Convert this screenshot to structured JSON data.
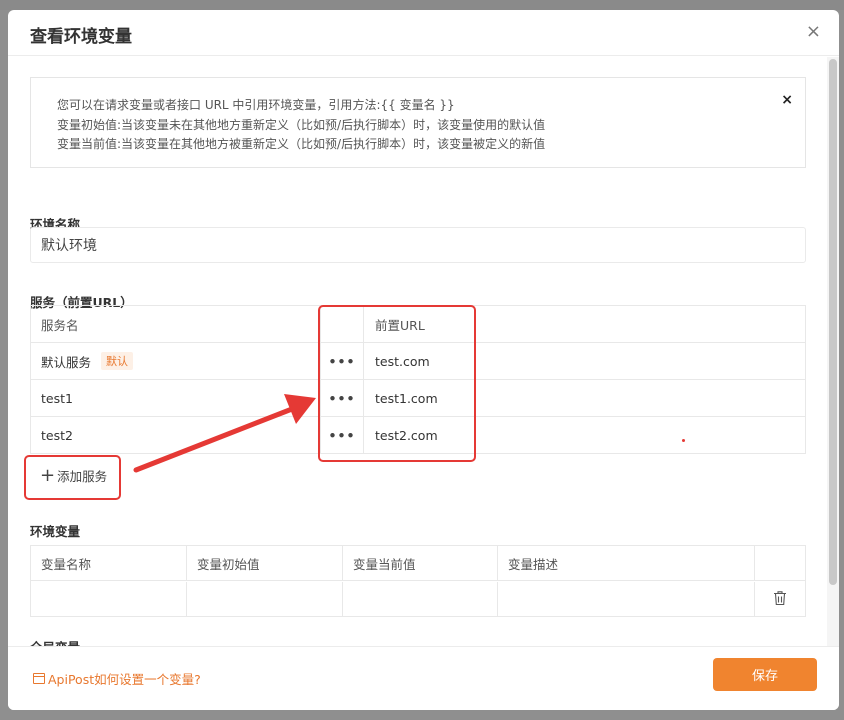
{
  "modal": {
    "title": "查看环境变量",
    "close_glyph": "×"
  },
  "notice": {
    "lines": [
      "您可以在请求变量或者接口 URL 中引用环境变量，引用方法:{{ 变量名 }}",
      "变量初始值:当该变量未在其他地方重新定义（比如预/后执行脚本）时，该变量使用的默认值",
      "变量当前值:当该变量在其他地方被重新定义（比如预/后执行脚本）时，该变量被定义的新值"
    ],
    "close_glyph": "×"
  },
  "env_name": {
    "label": "环境名称",
    "value": "默认环境"
  },
  "services": {
    "label": "服务（前置URL）",
    "columns": {
      "name": "服务名",
      "url": "前置URL"
    },
    "rows": [
      {
        "name": "默认服务",
        "tag": "默认",
        "dots": "•••",
        "url": "test.com"
      },
      {
        "name": "test1",
        "dots": "•••",
        "url": "test1.com"
      },
      {
        "name": "test2",
        "dots": "•••",
        "url": "test2.com"
      }
    ],
    "add_label": "添加服务",
    "add_glyph": "+"
  },
  "env_vars": {
    "label": "环境变量",
    "columns": [
      "变量名称",
      "变量初始值",
      "变量当前值",
      "变量描述"
    ]
  },
  "global_vars": {
    "label": "全局变量"
  },
  "footer": {
    "help_link": "ApiPost如何设置一个变量?",
    "save_label": "保存"
  },
  "colors": {
    "accent": "#f0842f",
    "annotation": "#e53935"
  },
  "icons": [
    "close-icon",
    "plus-icon",
    "trash-icon",
    "doc-icon"
  ]
}
